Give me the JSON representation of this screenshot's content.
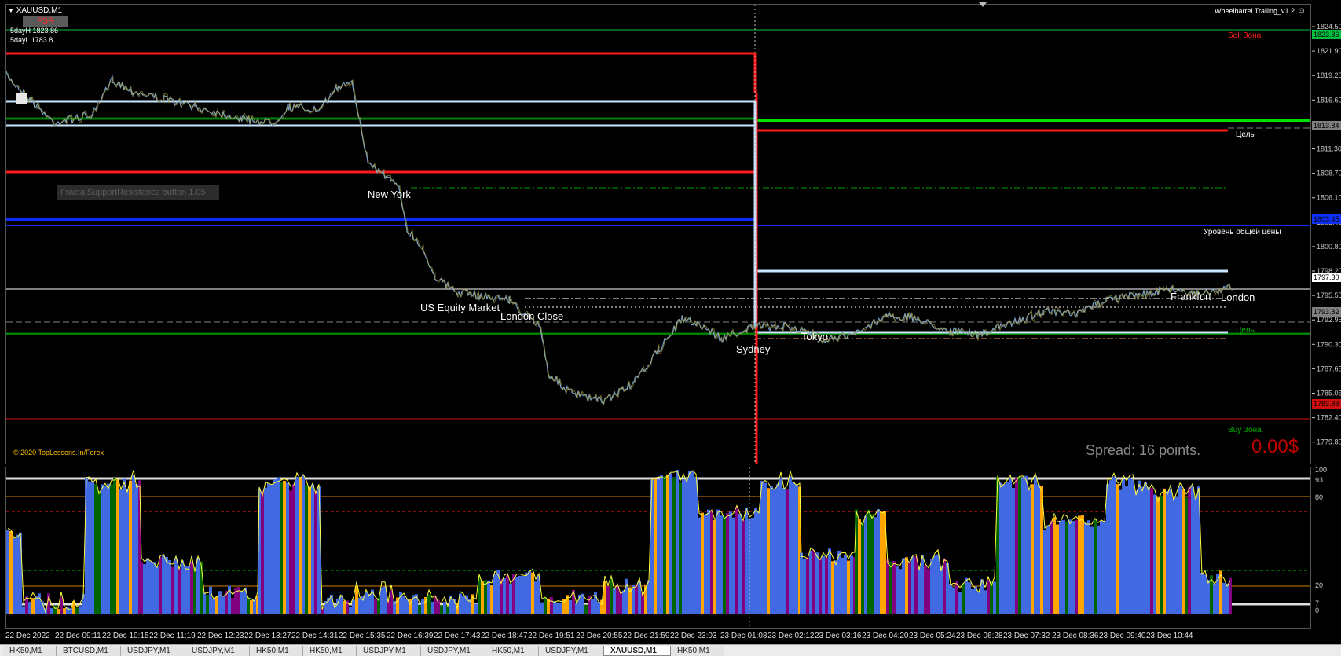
{
  "chart": {
    "symbol_label": "XAUUSD,M1",
    "expert_name": "Wheelbarrel Trailing_v1.2",
    "fsr_label": "FSR",
    "day_high_label": "5dayH 1823.86",
    "day_low_label": "5dayL 1783.8",
    "ea_button_label": "FractalSupportResistance button 1.05",
    "copyright": "© 2020 TopLessons.In/Forex",
    "spread_text": "Spread: 16 points.",
    "profit_text": "0.00$",
    "sell_zone_label": "Sell Зона",
    "buy_zone_label": "Buy Зона",
    "target_label_top": "Цель",
    "target_label_bottom": "Цель",
    "general_price_label": "Уровень общей цены",
    "sessions": {
      "new_york": "New York",
      "us_equity": "US Equity Market",
      "london_close": "London Close",
      "sydney": "Sydney",
      "tokyo": "Tokyo",
      "frankfurt": "Frankfurt",
      "london": "London"
    },
    "colors": {
      "background": "#000000",
      "sell_line": "#ff1a1a",
      "buy_line": "#00c000",
      "blue_level": "#0a2cff",
      "white_level": "#c8e6ff",
      "osc_fill": "#4169e1",
      "osc_alt": "#800080",
      "osc_orange": "#ffa500",
      "osc_green": "#006400"
    }
  },
  "price_axis": {
    "ticks": [
      "1824.50",
      "1821.90",
      "1819.20",
      "1816.60",
      "1813.90",
      "1811.30",
      "1808.70",
      "1806.10",
      "1803.40",
      "1800.80",
      "1798.20",
      "1795.55",
      "1792.95",
      "1790.30",
      "1787.65",
      "1785.05",
      "1782.40",
      "1779.80"
    ],
    "tags": [
      {
        "value": "1823.86",
        "color": "#00c040"
      },
      {
        "value": "1813.84",
        "color": "#808080"
      },
      {
        "value": "1803.45",
        "color": "#1030ff"
      },
      {
        "value": "1797.30",
        "color": "#ffffff"
      },
      {
        "value": "1793.82",
        "color": "#808080"
      },
      {
        "value": "1783.88",
        "color": "#d01010"
      }
    ]
  },
  "osc_axis": {
    "ticks": [
      "100",
      "93",
      "80",
      "20",
      "7",
      "0"
    ]
  },
  "time_axis": {
    "labels": [
      "22 Dec 2022",
      "22 Dec 09:11",
      "22 Dec 10:15",
      "22 Dec 11:19",
      "22 Dec 12:23",
      "22 Dec 13:27",
      "22 Dec 14:31",
      "22 Dec 15:35",
      "22 Dec 16:39",
      "22 Dec 17:43",
      "22 Dec 18:47",
      "22 Dec 19:51",
      "22 Dec 20:55",
      "22 Dec 21:59",
      "22 Dec 23:03",
      "23 Dec 01:08",
      "23 Dec 02:12",
      "23 Dec 03:16",
      "23 Dec 04:20",
      "23 Dec 05:24",
      "23 Dec 06:28",
      "23 Dec 07:32",
      "23 Dec 08:36",
      "23 Dec 09:40",
      "23 Dec 10:44"
    ]
  },
  "tabs": [
    {
      "label": "HK50,M1"
    },
    {
      "label": "BTCUSD,M1"
    },
    {
      "label": "USDJPY,M1"
    },
    {
      "label": "USDJPY,M1"
    },
    {
      "label": "HK50,M1"
    },
    {
      "label": "HK50,M1"
    },
    {
      "label": "USDJPY,M1"
    },
    {
      "label": "USDJPY,M1"
    },
    {
      "label": "HK50,M1"
    },
    {
      "label": "USDJPY,M1"
    },
    {
      "label": "XAUUSD,M1",
      "active": true
    },
    {
      "label": "HK50,M1"
    }
  ]
}
